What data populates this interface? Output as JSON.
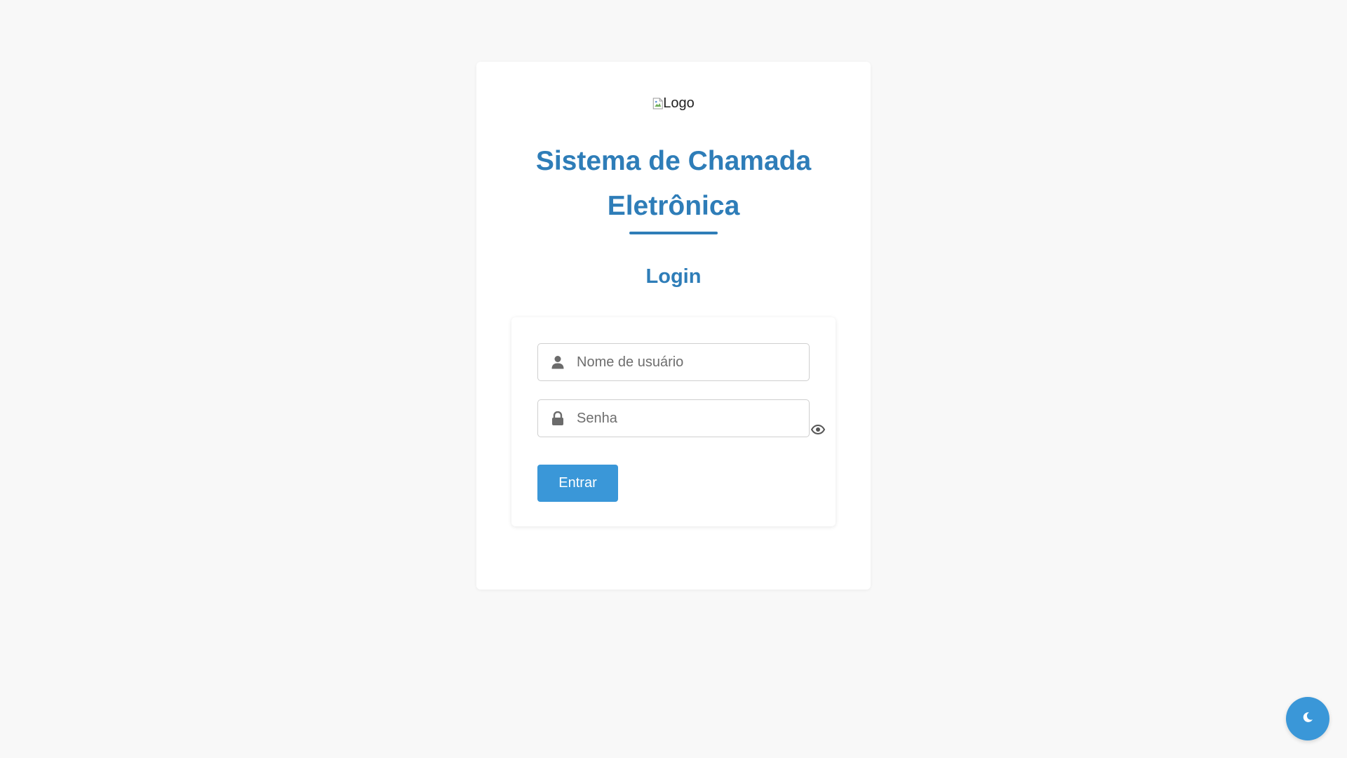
{
  "logo": {
    "alt_text": "Logo"
  },
  "header": {
    "title_line1": "Sistema de Chamada",
    "title_line2": "Eletrônica",
    "subtitle": "Login"
  },
  "form": {
    "username_placeholder": "Nome de usuário",
    "username_value": "",
    "password_placeholder": "Senha",
    "password_value": "",
    "submit_label": "Entrar"
  },
  "icons": {
    "username": "user-icon",
    "password": "lock-icon",
    "show_password": "eye-icon",
    "theme": "moon-icon"
  },
  "colors": {
    "brand": "#2e7db8",
    "button": "#3a97d8",
    "background": "#f8f8f8"
  }
}
